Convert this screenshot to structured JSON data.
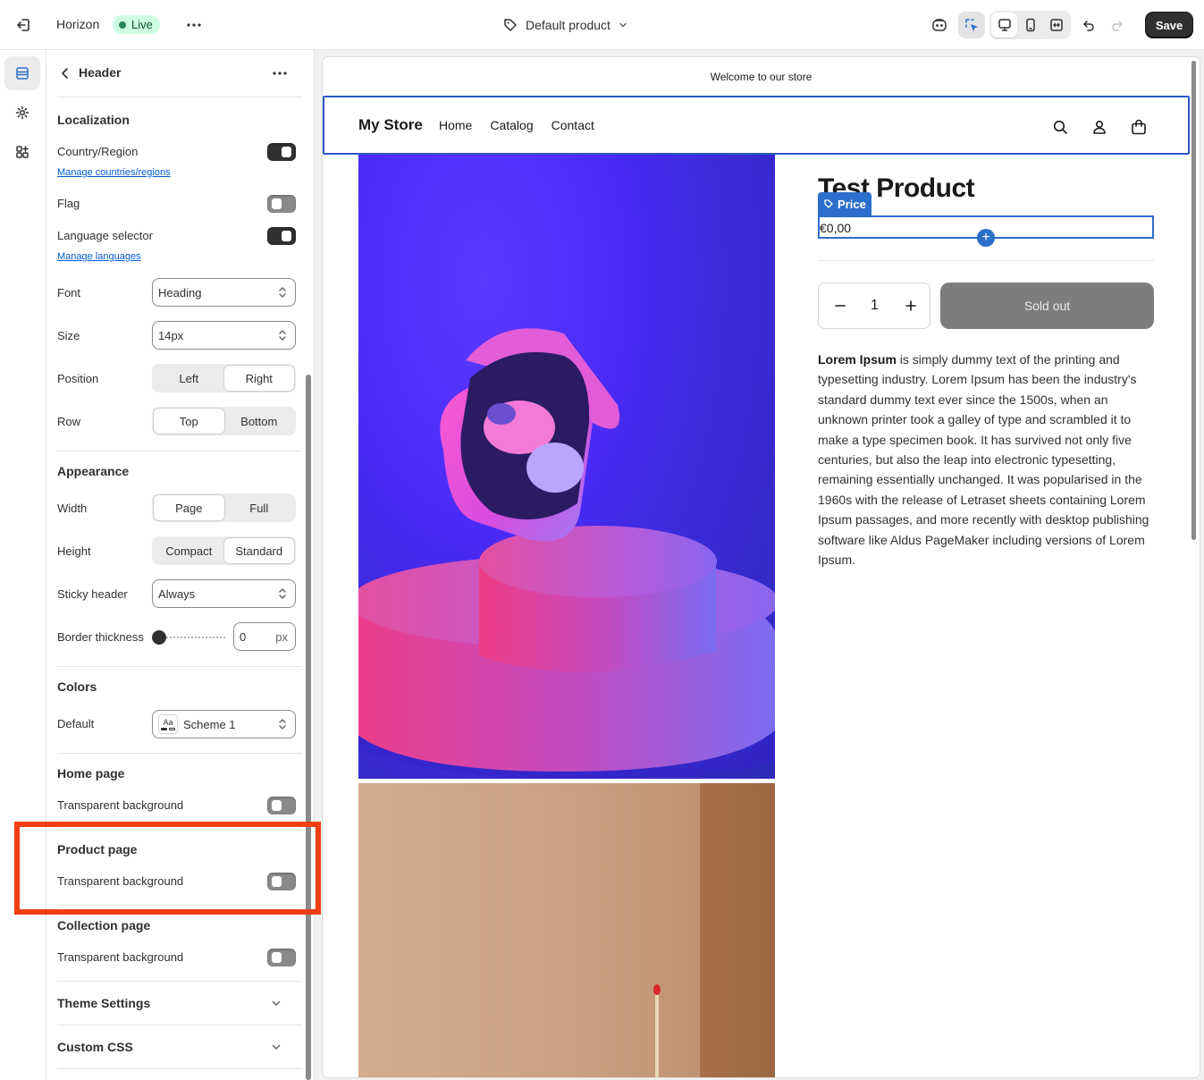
{
  "topbar": {
    "theme_name": "Horizon",
    "status": "Live",
    "template": "Default product",
    "save_label": "Save"
  },
  "panel": {
    "title": "Header",
    "localization": {
      "heading": "Localization",
      "country_label": "Country/Region",
      "country_on": true,
      "manage_countries": "Manage countries/regions",
      "flag_label": "Flag",
      "flag_on": false,
      "language_label": "Language selector",
      "language_on": true,
      "manage_languages": "Manage languages",
      "font_label": "Font",
      "font_value": "Heading",
      "size_label": "Size",
      "size_value": "14px",
      "position_label": "Position",
      "position_options": [
        "Left",
        "Right"
      ],
      "position_selected": "Right",
      "row_label": "Row",
      "row_options": [
        "Top",
        "Bottom"
      ],
      "row_selected": "Top"
    },
    "appearance": {
      "heading": "Appearance",
      "width_label": "Width",
      "width_options": [
        "Page",
        "Full"
      ],
      "width_selected": "Page",
      "height_label": "Height",
      "height_options": [
        "Compact",
        "Standard"
      ],
      "height_selected": "Standard",
      "sticky_label": "Sticky header",
      "sticky_value": "Always",
      "border_label": "Border thickness",
      "border_value": "0",
      "border_unit": "px"
    },
    "colors": {
      "heading": "Colors",
      "default_label": "Default",
      "scheme_icon_text": "Aa",
      "scheme_value": "Scheme 1"
    },
    "home_page": {
      "heading": "Home page",
      "label": "Transparent background",
      "on": false
    },
    "product_page": {
      "heading": "Product page",
      "label": "Transparent background",
      "on": false
    },
    "collection_page": {
      "heading": "Collection page",
      "label": "Transparent background",
      "on": false
    },
    "theme_settings": "Theme Settings",
    "custom_css": "Custom CSS"
  },
  "preview": {
    "announcement": "Welcome to our store",
    "store_name": "My Store",
    "nav": [
      "Home",
      "Catalog",
      "Contact"
    ],
    "product_title": "Test Product",
    "price_tag": "Price",
    "price": "€0,00",
    "quantity": "1",
    "sold_out": "Sold out",
    "description_bold": "Lorem Ipsum",
    "description_rest": " is simply dummy text of the printing and typesetting industry. Lorem Ipsum has been the industry's standard dummy text ever since the 1500s, when an unknown printer took a galley of type and scrambled it to make a type specimen book. It has survived not only five centuries, but also the leap into electronic typesetting, remaining essentially unchanged. It was popularised in the 1960s with the release of Letraset sheets containing Lorem Ipsum passages, and more recently with desktop publishing software like Aldus PageMaker including versions of Lorem Ipsum."
  },
  "colors": {
    "accent": "#2c6ecb",
    "highlight_box": "#f03e13",
    "live_badge_bg": "#cdfee1",
    "sold_out_bg": "#7d7d7d"
  }
}
